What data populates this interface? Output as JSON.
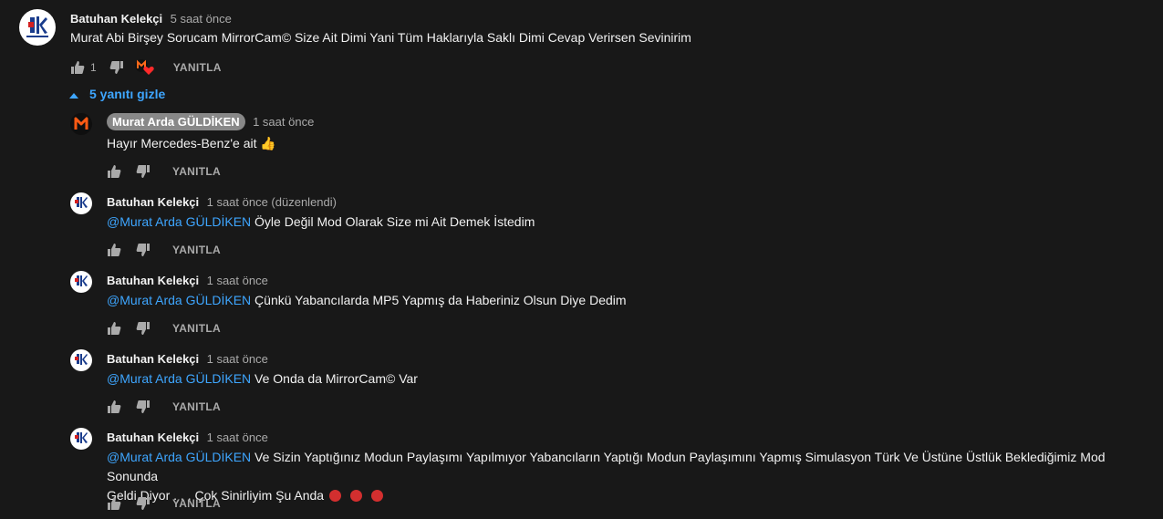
{
  "main_comment": {
    "author": "Batuhan Kelekçi",
    "time": "5 saat önce",
    "text": "Murat Abi Birşey Sorucam MirrorCam© Size Ait Dimi Yani Tüm Haklarıyla Saklı Dimi Cevap Verirsen Sevinirim",
    "like_count": "1",
    "reply_label": "YANITLA",
    "avatar_icon": "batuhan-avatar",
    "creator_heart_icon": "creator-heart"
  },
  "replies_toggle": {
    "label": "5 yanıtı gizle",
    "icon": "chevron-up",
    "color": "#3ea6ff"
  },
  "replies": [
    {
      "author": "Murat Arda GÜLDİKEN",
      "is_owner": true,
      "time": "1 saat önce",
      "mention": "",
      "text": "Hayır Mercedes-Benz'e ait 👍",
      "reply_label": "YANITLA"
    },
    {
      "author": "Batuhan Kelekçi",
      "time": "1 saat önce (düzenlendi)",
      "mention": "@Murat Arda GÜLDİKEN",
      "text": "Öyle Değil Mod Olarak Size mi Ait Demek İstedim",
      "reply_label": "YANITLA"
    },
    {
      "author": "Batuhan Kelekçi",
      "time": "1 saat önce",
      "mention": "@Murat Arda GÜLDİKEN",
      "text": "Çünkü Yabancılarda MP5 Yapmış da Haberiniz Olsun Diye Dedim",
      "reply_label": "YANITLA"
    },
    {
      "author": "Batuhan Kelekçi",
      "time": "1 saat önce",
      "mention": "@Murat Arda GÜLDİKEN",
      "text": "Ve Onda da MirrorCam© Var",
      "reply_label": "YANITLA"
    },
    {
      "author": "Batuhan Kelekçi",
      "time": "1 saat önce",
      "mention": "@Murat Arda GÜLDİKEN",
      "text_line1": "Ve Sizin Yaptığınız Modun Paylaşımı Yapılmıyor Yabancıların Yaptığı Modun Paylaşımını Yapmış Simulasyon Türk Ve Üstüne Üstlük Beklediğimiz Mod Sonunda",
      "text_line2": "Geldi Diyor . . . Çok Sinirliyim Şu Anda",
      "reply_label": "YANITLA"
    }
  ]
}
